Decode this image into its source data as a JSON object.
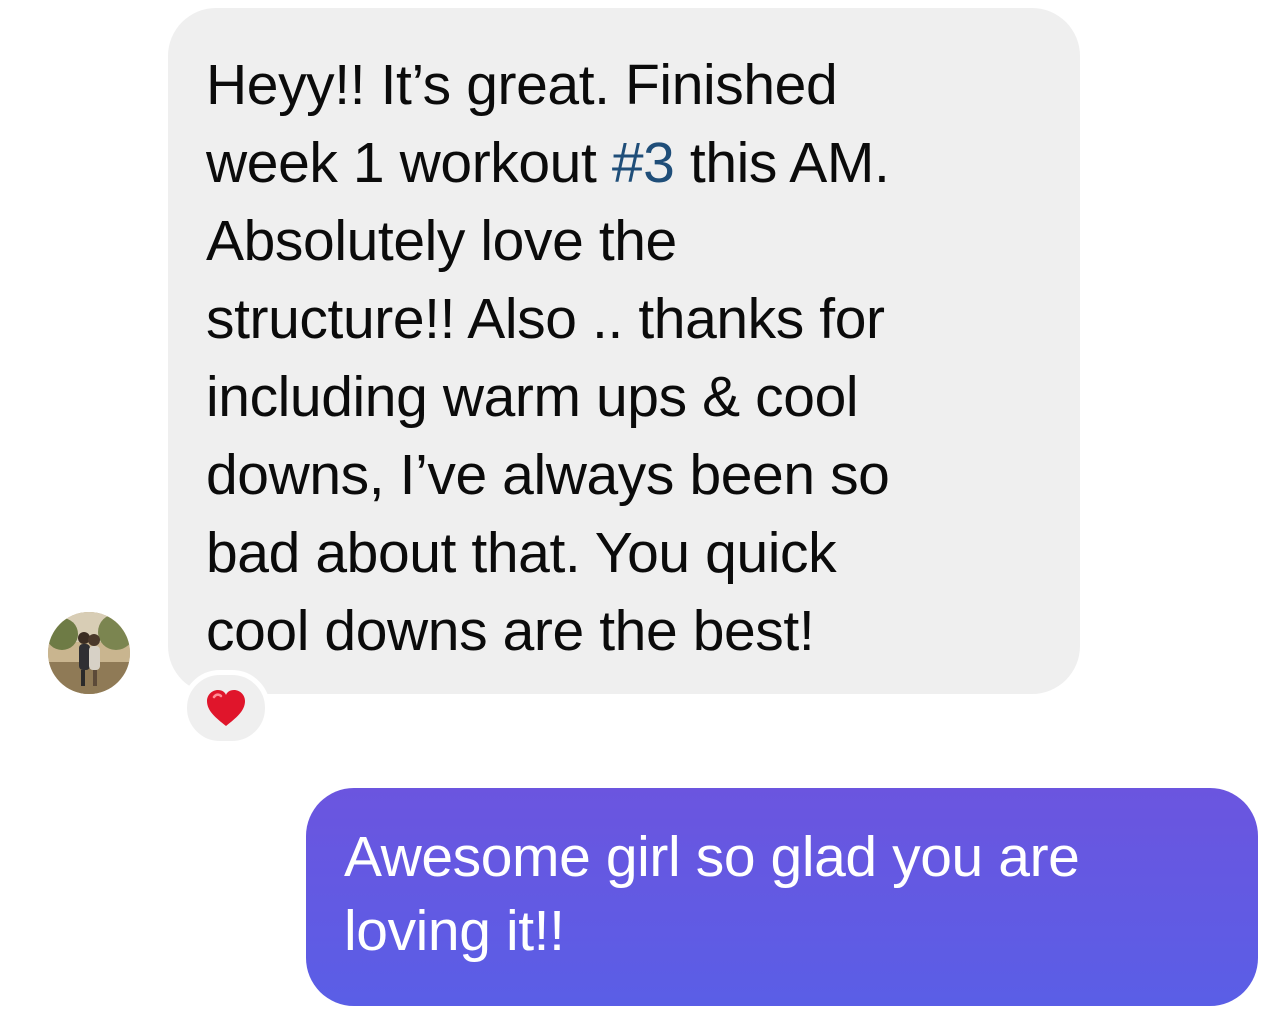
{
  "conversation": {
    "incoming": {
      "text_before_hashtag": "Heyy!! It’s great. Finished\nweek 1 workout ",
      "hashtag": "#3",
      "text_after_hashtag": " this AM.\nAbsolutely love the\nstructure!! Also .. thanks for\nincluding warm ups & cool\ndowns, I’ve always been so\nbad about that. You quick\ncool downs are the best!",
      "reaction": "heart-emoji"
    },
    "outgoing": {
      "text": "Awesome girl so glad you are\nloving it!!"
    }
  },
  "colors": {
    "incoming_bubble": "#efefef",
    "outgoing_bubble_top": "#6b55df",
    "outgoing_bubble_bottom": "#5a5ee6",
    "hashtag": "#1f4e79",
    "heart": "#e0152b"
  },
  "icons": {
    "avatar": "profile-photo",
    "reaction": "red-heart"
  }
}
